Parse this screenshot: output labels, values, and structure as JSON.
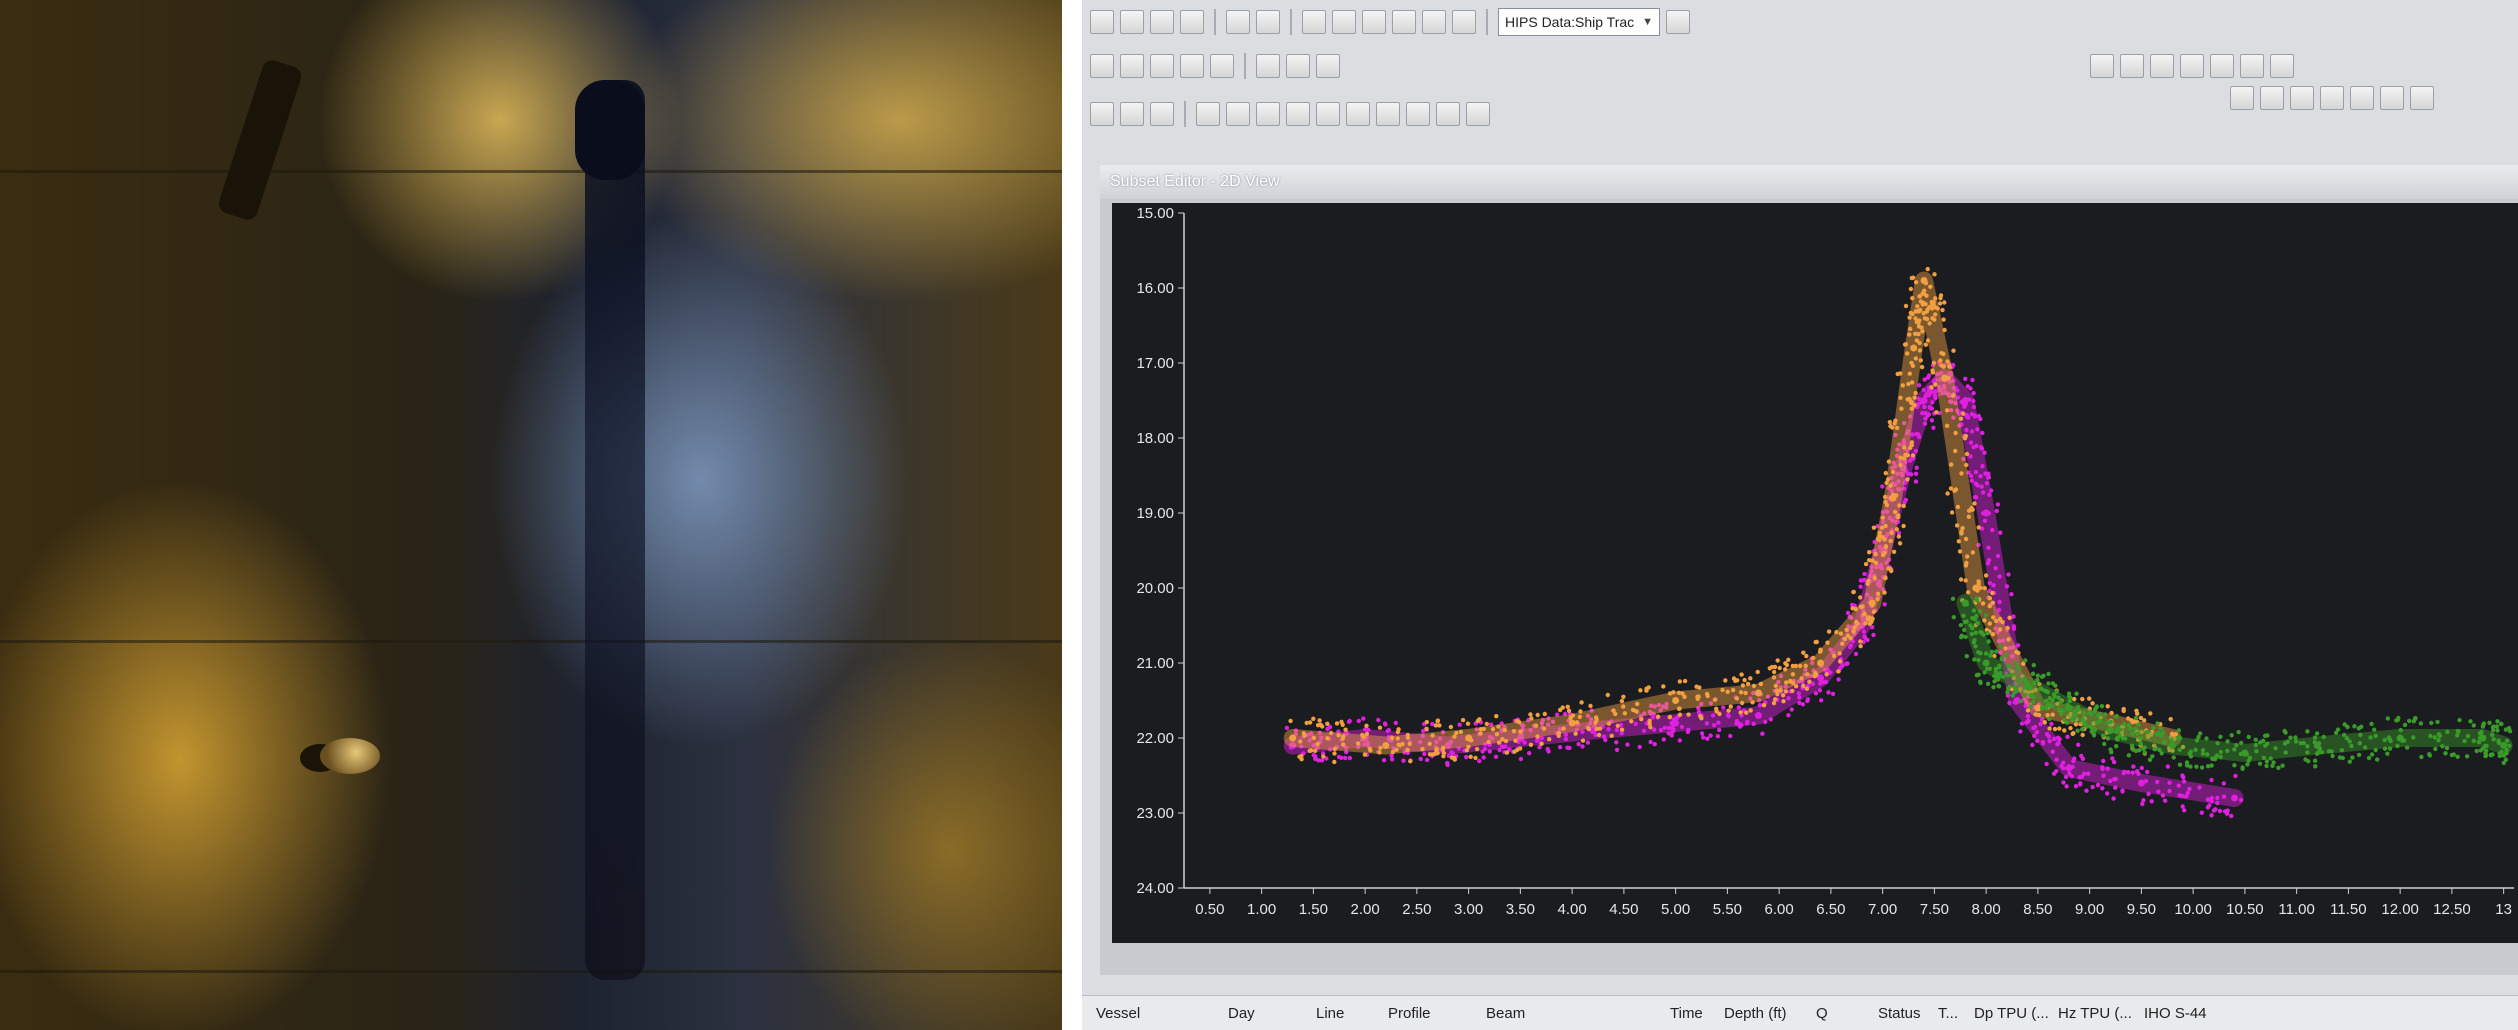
{
  "toolbar": {
    "dataset_dropdown": "HIPS Data:Ship Trac"
  },
  "editor": {
    "title": "Subset Editor - 2D View"
  },
  "status_bar": {
    "columns": [
      "Vessel",
      "Day",
      "Line",
      "Profile",
      "Beam",
      "Time",
      "Depth (ft)",
      "Q",
      "Status",
      "T...",
      "Dp TPU (...",
      "Hz TPU (...",
      "IHO S-44"
    ]
  },
  "chart_data": {
    "type": "scatter",
    "y_ticks": [
      "15.00",
      "16.00",
      "17.00",
      "18.00",
      "19.00",
      "20.00",
      "21.00",
      "22.00",
      "23.00",
      "24.00"
    ],
    "x_ticks": [
      "0.50",
      "1.00",
      "1.50",
      "2.00",
      "2.50",
      "3.00",
      "3.50",
      "4.00",
      "4.50",
      "5.00",
      "5.50",
      "6.00",
      "6.50",
      "7.00",
      "7.50",
      "8.00",
      "8.50",
      "9.00",
      "9.50",
      "10.00",
      "10.50",
      "11.00",
      "11.50",
      "12.00",
      "12.50",
      "13"
    ],
    "ylim": [
      15,
      24
    ],
    "xlim": [
      0.25,
      13.1
    ],
    "y_inverted": true,
    "series": [
      {
        "color": "#e020e0",
        "points": [
          [
            1.3,
            22.1
          ],
          [
            2.0,
            22.0
          ],
          [
            2.8,
            22.1
          ],
          [
            3.5,
            22.0
          ],
          [
            4.2,
            21.9
          ],
          [
            5.0,
            21.8
          ],
          [
            5.8,
            21.7
          ],
          [
            6.4,
            21.2
          ],
          [
            6.8,
            20.5
          ],
          [
            7.0,
            19.5
          ],
          [
            7.2,
            18.4
          ],
          [
            7.4,
            17.5
          ],
          [
            7.6,
            17.2
          ],
          [
            7.8,
            17.5
          ],
          [
            8.0,
            19.0
          ],
          [
            8.3,
            21.5
          ],
          [
            8.8,
            22.4
          ],
          [
            9.5,
            22.6
          ],
          [
            10.4,
            22.8
          ]
        ]
      },
      {
        "color": "#f0a040",
        "points": [
          [
            1.3,
            22.0
          ],
          [
            2.2,
            22.1
          ],
          [
            3.0,
            22.0
          ],
          [
            4.0,
            21.8
          ],
          [
            5.0,
            21.5
          ],
          [
            5.8,
            21.4
          ],
          [
            6.4,
            21.0
          ],
          [
            6.9,
            20.2
          ],
          [
            7.1,
            18.8
          ],
          [
            7.3,
            16.8
          ],
          [
            7.4,
            15.9
          ],
          [
            7.6,
            17.2
          ],
          [
            7.9,
            20.0
          ],
          [
            8.5,
            21.6
          ],
          [
            9.2,
            21.8
          ],
          [
            9.8,
            22.0
          ]
        ]
      },
      {
        "color": "#3a9a2a",
        "points": [
          [
            7.8,
            20.2
          ],
          [
            8.0,
            21.0
          ],
          [
            8.4,
            21.3
          ],
          [
            8.8,
            21.6
          ],
          [
            9.2,
            21.9
          ],
          [
            9.8,
            22.1
          ],
          [
            10.5,
            22.2
          ],
          [
            11.2,
            22.1
          ],
          [
            12.0,
            22.0
          ],
          [
            12.8,
            22.0
          ],
          [
            13.0,
            22.1
          ]
        ]
      }
    ]
  }
}
